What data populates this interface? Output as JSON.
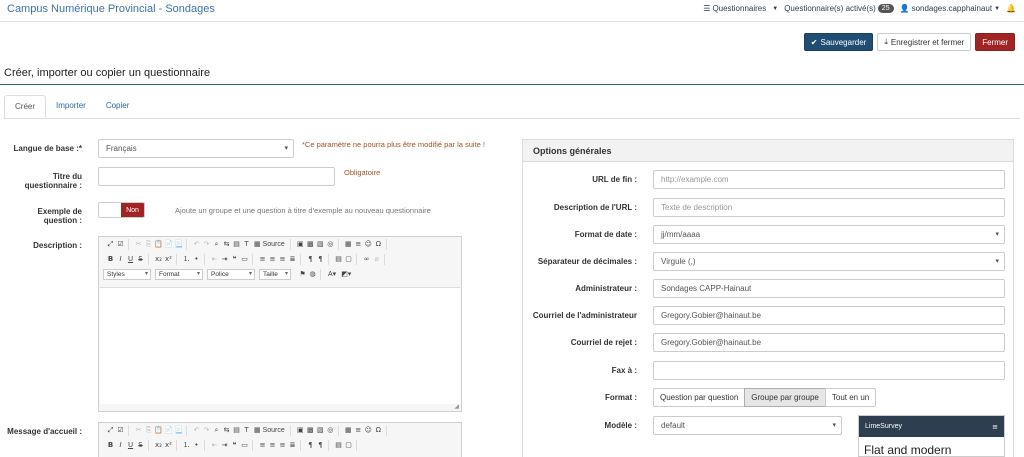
{
  "app": {
    "title": "Campus Numérique Provincial - Sondages"
  },
  "topnav": {
    "questionnaires": "Questionnaires",
    "active_label": "Questionnaire(s) activé(s)",
    "active_count": "25",
    "user": "sondages.capphainaut"
  },
  "actions": {
    "save": "Sauvegarder",
    "save_close": "Enregistrer et fermer",
    "close": "Fermer"
  },
  "page": {
    "title": "Créer, importer ou copier un questionnaire"
  },
  "tabs": [
    "Créer",
    "Importer",
    "Copier"
  ],
  "form": {
    "language_label": "Langue de base :*",
    "language_value": "Français",
    "language_note": "*Ce paramètre ne pourra plus être modifié par la suite !",
    "title_label_1": "Titre du",
    "title_label_2": "questionnaire :",
    "title_note": "Obligatoire",
    "example_label_1": "Exemple de",
    "example_label_2": "question :",
    "example_toggle": "Non",
    "example_note": "Ajoute un groupe et une question à titre d'exemple au nouveau questionnaire",
    "description_label": "Description :",
    "welcome_label": "Message d'accueil :"
  },
  "editor": {
    "source_label": "Source",
    "styles": "Styles",
    "format": "Format",
    "font": "Police",
    "size": "Taille"
  },
  "options": {
    "title": "Options générales",
    "end_url_label": "URL de fin :",
    "end_url_placeholder": "http://example.com",
    "url_desc_label": "Description de l'URL :",
    "url_desc_placeholder": "Texte de description",
    "date_format_label": "Format de date :",
    "date_format_value": "jj/mm/aaaa",
    "decimal_label": "Séparateur de décimales :",
    "decimal_value": "Virgule (,)",
    "admin_label": "Administrateur :",
    "admin_value": "Sondages CAPP-Hainaut",
    "admin_email_label": "Courriel de l'administrateur",
    "admin_email_value": "Gregory.Gobier@hainaut.be",
    "bounce_email_label": "Courriel de rejet :",
    "bounce_email_value": "Gregory.Gobier@hainaut.be",
    "fax_label": "Fax à :",
    "format_label": "Format :",
    "format_options": [
      "Question par question",
      "Groupe par groupe",
      "Tout en un"
    ],
    "format_selected": "Groupe par groupe",
    "template_label": "Modèle :",
    "template_value": "default",
    "preview_brand": "LimeSurvey",
    "preview_heading": "Flat and modern"
  }
}
